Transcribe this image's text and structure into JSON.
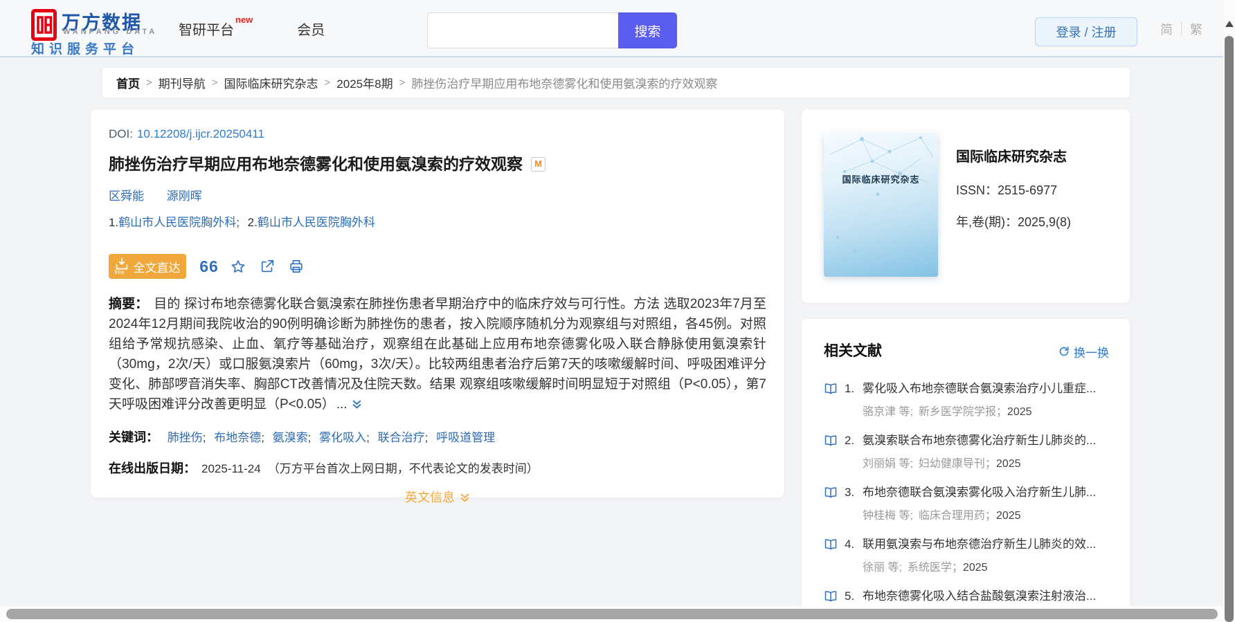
{
  "colors": {
    "brand_red": "#e60012",
    "brand_blue": "#1e56a9",
    "link_blue": "#2d6fc1",
    "accent_orange": "#f0a73b",
    "search_button_purple": "#5b5cf0"
  },
  "icons": {
    "quote_glyph": "66"
  },
  "header": {
    "logo": {
      "brand_cn": "万方数据",
      "brand_en": "WANFANG DATA",
      "tagline": "知识服务平台"
    },
    "nav": [
      {
        "label": "智研平台",
        "badge": "new"
      },
      {
        "label": "会员"
      }
    ],
    "search": {
      "placeholder": "",
      "button_label": "搜索"
    },
    "auth": {
      "login_register": "登录 / 注册",
      "lang_simplified": "简",
      "lang_traditional": "繁"
    }
  },
  "breadcrumb": {
    "separator": ">",
    "items": [
      "首页",
      "期刊导航",
      "国际临床研究杂志",
      "2025年8期",
      "肺挫伤治疗早期应用布地奈德雾化和使用氨溴索的疗效观察"
    ]
  },
  "article": {
    "doi_label": "DOI:",
    "doi": "10.12208/j.ijcr.20250411",
    "title": "肺挫伤治疗早期应用布地奈德雾化和使用氨溴索的疗效观察",
    "title_badge": "M",
    "authors": [
      "区舜能",
      "源刚晖"
    ],
    "affiliation_separator": ";",
    "affiliations": [
      {
        "index": "1.",
        "name": "鹤山市人民医院胸外科"
      },
      {
        "index": "2.",
        "name": "鹤山市人民医院胸外科"
      }
    ],
    "actions": {
      "fulltext_label": "全文直达",
      "fulltext_free": "free"
    },
    "abstract_label": "摘要：",
    "abstract": "目的 探讨布地奈德雾化联合氨溴索在肺挫伤患者早期治疗中的临床疗效与可行性。方法 选取2023年7月至2024年12月期间我院收治的90例明确诊断为肺挫伤的患者，按入院顺序随机分为观察组与对照组，各45例。对照组给予常规抗感染、止血、氧疗等基础治疗，观察组在此基础上应用布地奈德雾化吸入联合静脉使用氨溴索针（30mg，2次/天）或口服氨溴索片（60mg，3次/天）。比较两组患者治疗后第7天的咳嗽缓解时间、呼吸困难评分变化、肺部啰音消失率、胸部CT改善情况及住院天数。结果 观察组咳嗽缓解时间明显短于对照组（P<0.05），第7天呼吸困难评分改善更明显（P<0.05）",
    "abstract_more": "...",
    "keywords_label": "关键词：",
    "keyword_separator": ";",
    "keywords": [
      "肺挫伤",
      "布地奈德",
      "氨溴索",
      "雾化吸入",
      "联合治疗",
      "呼吸道管理"
    ],
    "pubdate_label": "在线出版日期：",
    "pubdate": "2025-11-24",
    "pubdate_note": "（万方平台首次上网日期，不代表论文的发表时间）",
    "english_info_label": "英文信息"
  },
  "journal": {
    "cover_title": "国际临床研究杂志",
    "name": "国际临床研究杂志",
    "issn_label": "ISSN：",
    "issn": "2515-6977",
    "vol_label": "年,卷(期)：",
    "volume": "2025,9(8)"
  },
  "related": {
    "title": "相关文献",
    "refresh_label": "换一换",
    "items": [
      {
        "no": "1.",
        "title": "雾化吸入布地奈德联合氨溴索治疗小儿重症...",
        "authors": "骆京津 等;",
        "journal": "新乡医学院学报；",
        "year": "2025"
      },
      {
        "no": "2.",
        "title": "氨溴索联合布地奈德雾化治疗新生儿肺炎的...",
        "authors": "刘丽娟 等;",
        "journal": "妇幼健康导刊；",
        "year": "2025"
      },
      {
        "no": "3.",
        "title": "布地奈德联合氨溴索雾化吸入治疗新生儿肺...",
        "authors": "钟桂梅 等;",
        "journal": "临床合理用药；",
        "year": "2025"
      },
      {
        "no": "4.",
        "title": "联用氨溴索与布地奈德治疗新生儿肺炎的效...",
        "authors": "徐丽 等;",
        "journal": "系统医学；",
        "year": "2025"
      },
      {
        "no": "5.",
        "title": "布地奈德雾化吸入结合盐酸氨溴索注射液治..."
      }
    ]
  }
}
